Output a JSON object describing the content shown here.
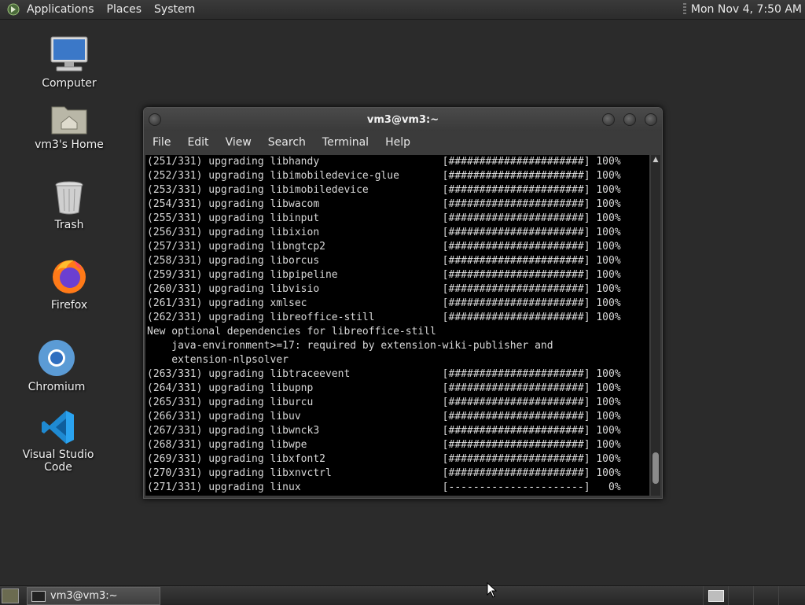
{
  "top_panel": {
    "menus": [
      "Applications",
      "Places",
      "System"
    ],
    "clock": "Mon Nov 4, 7:50 AM"
  },
  "desktop_icons": [
    {
      "label": "Computer",
      "icon": "computer-icon"
    },
    {
      "label": "vm3's Home",
      "icon": "home-folder-icon"
    },
    {
      "label": "Trash",
      "icon": "trash-icon"
    },
    {
      "label": "Firefox",
      "icon": "firefox-icon"
    },
    {
      "label": "Chromium",
      "icon": "chromium-icon"
    },
    {
      "label": "Visual Studio Code",
      "icon": "vscode-icon"
    }
  ],
  "terminal": {
    "title": "vm3@vm3:~",
    "menu": [
      "File",
      "Edit",
      "View",
      "Search",
      "Terminal",
      "Help"
    ],
    "lines": [
      "(251/331) upgrading libhandy                    [######################] 100%",
      "(252/331) upgrading libimobiledevice-glue       [######################] 100%",
      "(253/331) upgrading libimobiledevice            [######################] 100%",
      "(254/331) upgrading libwacom                    [######################] 100%",
      "(255/331) upgrading libinput                    [######################] 100%",
      "(256/331) upgrading libixion                    [######################] 100%",
      "(257/331) upgrading libngtcp2                   [######################] 100%",
      "(258/331) upgrading liborcus                    [######################] 100%",
      "(259/331) upgrading libpipeline                 [######################] 100%",
      "(260/331) upgrading libvisio                    [######################] 100%",
      "(261/331) upgrading xmlsec                      [######################] 100%",
      "(262/331) upgrading libreoffice-still           [######################] 100%",
      "New optional dependencies for libreoffice-still",
      "    java-environment>=17: required by extension-wiki-publisher and",
      "    extension-nlpsolver",
      "(263/331) upgrading libtraceevent               [######################] 100%",
      "(264/331) upgrading libupnp                     [######################] 100%",
      "(265/331) upgrading liburcu                     [######################] 100%",
      "(266/331) upgrading libuv                       [######################] 100%",
      "(267/331) upgrading libwnck3                    [######################] 100%",
      "(268/331) upgrading libwpe                      [######################] 100%",
      "(269/331) upgrading libxfont2                   [######################] 100%",
      "(270/331) upgrading libxnvctrl                  [######################] 100%",
      "(271/331) upgrading linux                       [----------------------]   0%"
    ]
  },
  "taskbar": {
    "window_button": "vm3@vm3:~"
  },
  "colors": {
    "desktop_bg": "#2b2b2b",
    "terminal_bg": "#000000",
    "terminal_fg": "#d8d8d8"
  }
}
